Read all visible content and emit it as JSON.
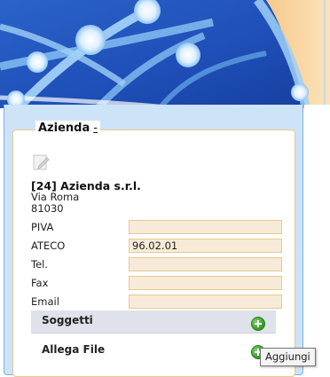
{
  "panel": {
    "legend": "Azienda",
    "collapse_link": "-"
  },
  "company": {
    "title": "[24] Azienda s.r.l.",
    "street": "Via Roma",
    "zip": "81030"
  },
  "fields": {
    "piva_label": "PIVA",
    "piva_value": "",
    "ateco_label": "ATECO",
    "ateco_value": "96.02.01",
    "tel_label": "Tel.",
    "tel_value": "",
    "fax_label": "Fax",
    "fax_value": "",
    "email_label": "Email",
    "email_value": ""
  },
  "sections": {
    "soggetti_label": "Soggetti",
    "allega_label": "Allega File"
  },
  "tooltip": {
    "text": "Aggiungi"
  },
  "icons": {
    "edit": "edit-icon",
    "add": "add-icon"
  },
  "colors": {
    "frame_bg": "#cde3f7",
    "field_bg": "#f7ead8",
    "field_border": "#e8c990",
    "section_bg": "#dfe2ea",
    "add_green": "#2e9a22"
  }
}
